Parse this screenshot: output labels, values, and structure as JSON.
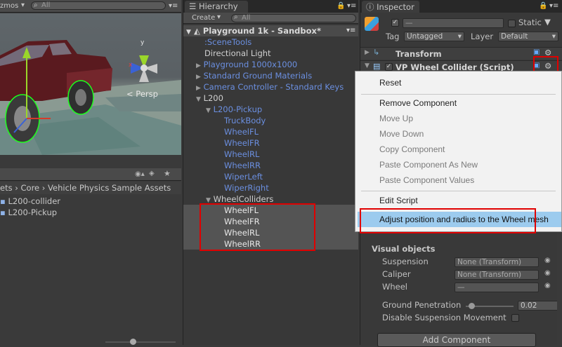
{
  "scene": {
    "tools_label": "zmos",
    "search_placeholder": "All",
    "persp_label": "< Persp"
  },
  "project": {
    "breadcrumb": [
      "ets",
      "Core",
      "Vehicle Physics Sample Assets"
    ],
    "items": [
      "L200-collider",
      "L200-Pickup"
    ]
  },
  "hierarchy": {
    "tab_label": "Hierarchy",
    "create_label": "Create",
    "search_placeholder": "All",
    "scene_title": "Playground 1k - Sandbox*",
    "rows": [
      {
        "label": ":SceneTools"
      },
      {
        "label": "Directional Light"
      },
      {
        "label": "Playground 1000x1000"
      },
      {
        "label": "Standard Ground Materials"
      },
      {
        "label": "Camera Controller - Standard Keys"
      },
      {
        "label": "L200"
      },
      {
        "label": "L200-Pickup"
      },
      {
        "label": "TruckBody"
      },
      {
        "label": "WheelFL"
      },
      {
        "label": "WheelFR"
      },
      {
        "label": "WheelRL"
      },
      {
        "label": "WheelRR"
      },
      {
        "label": "WiperLeft"
      },
      {
        "label": "WiperRight"
      },
      {
        "label": "WheelColliders"
      },
      {
        "label": "WheelFL"
      },
      {
        "label": "WheelFR"
      },
      {
        "label": "WheelRL"
      },
      {
        "label": "WheelRR"
      }
    ]
  },
  "inspector": {
    "tab_label": "Inspector",
    "static_label": "Static",
    "name_value": "—",
    "tag_label": "Tag",
    "tag_value": "Untagged",
    "layer_label": "Layer",
    "layer_value": "Default",
    "transform_label": "Transform",
    "component_label": "VP Wheel Collider (Script)",
    "visual_objects_heading": "Visual objects",
    "suspension_label": "Suspension",
    "suspension_value": "None (Transform)",
    "caliper_label": "Caliper",
    "caliper_value": "None (Transform)",
    "wheel_label": "Wheel",
    "wheel_value": "—",
    "ground_penetration_label": "Ground Penetration",
    "ground_penetration_value": "0.02",
    "disable_suspension_label": "Disable Suspension Movement",
    "add_component_label": "Add Component"
  },
  "context_menu": {
    "reset": "Reset",
    "remove_component": "Remove Component",
    "move_up": "Move Up",
    "move_down": "Move Down",
    "copy_component": "Copy Component",
    "paste_as_new": "Paste Component As New",
    "paste_values": "Paste Component Values",
    "edit_script": "Edit Script",
    "adjust": "Adjust position and radius to the Wheel mesh"
  },
  "colors": {
    "highlight_box": "#e00000",
    "menu_selection": "#9ccbee",
    "prefab_blue": "#6b8fe0"
  }
}
